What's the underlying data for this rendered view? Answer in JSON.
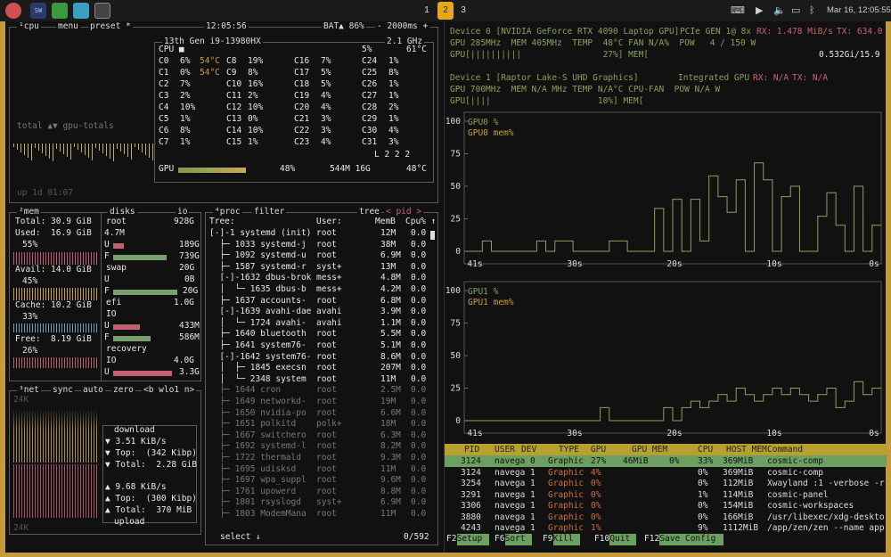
{
  "topbar": {
    "workspaces": [
      "1",
      "2",
      "3"
    ],
    "active_ws": "2",
    "datetime": "Mar 16, 12:05:55"
  },
  "cpu": {
    "header_num": "¹",
    "title": "cpu",
    "menu": "menu",
    "preset": "preset *",
    "time": "12:05:56",
    "bat": "BAT▲ 86%",
    "interval": "- 2000ms +",
    "model": "13th Gen i9-13980HX",
    "freq": "2.1 GHz",
    "total_pct": "5%",
    "total_temp": "61°C",
    "graph_label": "total ▲▼ gpu-totals",
    "uptime": "up 1d 01:07",
    "load": "L 2 2 2",
    "gpu_line": {
      "label": "GPU",
      "pct": "48%",
      "mem": "544M 16G",
      "temp": "48°C"
    },
    "cores": [
      [
        "C0",
        "6%",
        "54°C",
        "C8",
        "19%",
        "C16",
        "7%",
        "C24",
        "1%"
      ],
      [
        "C1",
        "0%",
        "54°C",
        "C9",
        "8%",
        "C17",
        "5%",
        "C25",
        "8%"
      ],
      [
        "C2",
        "7%",
        "",
        "C10",
        "16%",
        "C18",
        "5%",
        "C26",
        "1%"
      ],
      [
        "C3",
        "2%",
        "",
        "C11",
        "2%",
        "C19",
        "4%",
        "C27",
        "1%"
      ],
      [
        "C4",
        "10%",
        "",
        "C12",
        "10%",
        "C20",
        "4%",
        "C28",
        "2%"
      ],
      [
        "C5",
        "1%",
        "",
        "C13",
        "0%",
        "C21",
        "3%",
        "C29",
        "1%"
      ],
      [
        "C6",
        "8%",
        "",
        "C14",
        "10%",
        "C22",
        "3%",
        "C30",
        "4%"
      ],
      [
        "C7",
        "1%",
        "",
        "C15",
        "1%",
        "C23",
        "4%",
        "C31",
        "3%"
      ]
    ]
  },
  "mem": {
    "num": "²",
    "title": "mem",
    "total": "Total: 30.9 GiB",
    "used": "Used:  16.9 GiB",
    "used_pct": "55%",
    "avail": "Avail: 14.0 GiB",
    "avail_pct": "45%",
    "cache": "Cache: 10.2 GiB",
    "cache_pct": "33%",
    "free": "Free:  8.19 GiB",
    "free_pct": "26%"
  },
  "disks": {
    "title": "disks",
    "io": "io",
    "root": "root",
    "root_size": "928G",
    "root_io": "4.7M",
    "root_u": "189G",
    "root_f": "739G",
    "swap": "swap",
    "swap_size": "20G",
    "swap_u": "0B",
    "swap_f": "20G",
    "efi": "efi",
    "efi_size": "1.0G",
    "efi_io": "IO",
    "efi_u": "433M",
    "efi_f": "586M",
    "recovery": "recovery",
    "rec_size": "4.0G",
    "rec_io": "IO",
    "rec_u": "3.3G",
    "u": "U",
    "f": "F"
  },
  "net": {
    "num": "³",
    "title": "net",
    "sync": "sync",
    "auto": "auto",
    "zero": "zero",
    "iface": "<b wlo1 n>",
    "scale_top": "24K",
    "scale_bot": "24K",
    "download": "download",
    "dl_rate": "▼ 3.51 KiB/s",
    "dl_top": "▼ Top:  (342 Kibp)",
    "dl_total": "▼ Total:  2.28 GiB",
    "ul_rate": "▲ 9.68 KiB/s",
    "ul_top": "▲ Top:  (300 Kibp)",
    "ul_total": "▲ Total:  370 MiB",
    "upload": "upload"
  },
  "proc": {
    "num": "⁴",
    "title": "proc",
    "filter": "filter",
    "tree": "tree",
    "sort": "< pid >",
    "hdr_tree": "Tree:",
    "hdr_user": "User:",
    "hdr_mem": "MemB",
    "hdr_cpu": "Cpu% ↑",
    "select": "select ↓",
    "count": "0/592",
    "rows": [
      [
        "[-]-1 systemd (init)",
        "root",
        "12M",
        "0.0"
      ],
      [
        "  ├─ 1033 systemd-j",
        "root",
        "38M",
        "0.0"
      ],
      [
        "  ├─ 1092 systemd-u",
        "root",
        "6.9M",
        "0.0"
      ],
      [
        "  ├─ 1587 systemd-r",
        "syst+",
        "13M",
        "0.0"
      ],
      [
        "  [-]-1632 dbus-brok",
        "mess+",
        "4.8M",
        "0.0"
      ],
      [
        "  │  └─ 1635 dbus-b",
        "mess+",
        "4.2M",
        "0.0"
      ],
      [
        "  ├─ 1637 accounts-",
        "root",
        "6.8M",
        "0.0"
      ],
      [
        "  [-]-1639 avahi-dae",
        "avahi",
        "3.9M",
        "0.0"
      ],
      [
        "  │  └─ 1724 avahi-",
        "avahi",
        "1.1M",
        "0.0"
      ],
      [
        "  ├─ 1640 bluetooth",
        "root",
        "5.5M",
        "0.0"
      ],
      [
        "  ├─ 1641 system76-",
        "root",
        "5.1M",
        "0.0"
      ],
      [
        "  [-]-1642 system76-",
        "root",
        "8.6M",
        "0.0"
      ],
      [
        "  │  ├─ 1845 execsn",
        "root",
        "207M",
        "0.0"
      ],
      [
        "  │  └─ 2348 system",
        "root",
        "11M",
        "0.0"
      ],
      [
        "  ├─ 1644 cron",
        "root",
        "2.5M",
        "0.0"
      ],
      [
        "  ├─ 1649 networkd-",
        "root",
        "19M",
        "0.0"
      ],
      [
        "  ├─ 1650 nvidia-po",
        "root",
        "6.6M",
        "0.0"
      ],
      [
        "  ├─ 1651 polkitd",
        "polk+",
        "18M",
        "0.0"
      ],
      [
        "  ├─ 1667 switchero",
        "root",
        "6.3M",
        "0.0"
      ],
      [
        "  ├─ 1692 systemd-l",
        "root",
        "8.2M",
        "0.0"
      ],
      [
        "  ├─ 1722 thermald",
        "root",
        "9.3M",
        "0.0"
      ],
      [
        "  ├─ 1695 udisksd",
        "root",
        "11M",
        "0.0"
      ],
      [
        "  ├─ 1697 wpa_suppl",
        "root",
        "9.6M",
        "0.0"
      ],
      [
        "  ├─ 1761 upowerd",
        "root",
        "8.8M",
        "0.0"
      ],
      [
        "  ├─ 1801 rsyslogd",
        "syst+",
        "6.9M",
        "0.0"
      ],
      [
        "  ├─ 1803 ModemMana",
        "root",
        "11M",
        "0.0"
      ]
    ]
  },
  "gpu": {
    "dev0": "Device 0 [NVIDIA GeForce RTX 4090 Laptop GPU]",
    "pcie": "PCIe GEN 1@ 8x",
    "rx0": "RX: 1.478 MiB/s",
    "tx0": "TX: 634.0",
    "gpu0_line": "GPU 285MHz  MEM 405MHz  TEMP  48°C FAN N/A%  POW   4 / 150 W",
    "gpu0_bar": "GPU[||||||||||                27%] MEM[",
    "gpu0_mem": "0.532Gi/15.9",
    "dev1": "Device 1 [Raptor Lake-S UHD Graphics]",
    "integrated": "Integrated GPU",
    "rx1": "RX: N/A",
    "tx1": "TX: N/A",
    "gpu1_line": "GPU 700MHz  MEM N/A MHz TEMP N/A°C CPU-FAN  POW N/A W",
    "gpu1_bar": "GPU[||||                     10%] MEM[",
    "g0_legend1": "GPU0 %",
    "g0_legend2": "GPU0 mem%",
    "g1_legend1": "GPU1 %",
    "g1_legend2": "GPU1 mem%",
    "yticks": [
      "100",
      "75",
      "50",
      "25",
      "0"
    ],
    "xticks": [
      "41s",
      "30s",
      "20s",
      "10s",
      "0s"
    ],
    "proc_header": [
      "PID",
      "USER",
      "DEV",
      "TYPE",
      "GPU",
      "GPU MEM",
      "CPU",
      "HOST MEM",
      "Command"
    ],
    "procs": [
      [
        "3124",
        "navega",
        "0",
        "Graphic",
        "27%",
        "46MiB",
        "0%",
        "33%",
        "369MiB",
        "cosmic-comp"
      ],
      [
        "3124",
        "navega",
        "1",
        "Graphic",
        "4%",
        "",
        "",
        "0%",
        "369MiB",
        "cosmic-comp"
      ],
      [
        "3254",
        "navega",
        "1",
        "Graphic",
        "0%",
        "",
        "",
        "0%",
        "112MiB",
        "Xwayland :1 -verbose -r"
      ],
      [
        "3291",
        "navega",
        "1",
        "Graphic",
        "0%",
        "",
        "",
        "1%",
        "114MiB",
        "cosmic-panel"
      ],
      [
        "3306",
        "navega",
        "1",
        "Graphic",
        "0%",
        "",
        "",
        "0%",
        "154MiB",
        "cosmic-workspaces"
      ],
      [
        "3880",
        "navega",
        "1",
        "Graphic",
        "0%",
        "",
        "",
        "0%",
        "166MiB",
        "/usr/libexec/xdg-deskto"
      ],
      [
        "4243",
        "navega",
        "1",
        "Graphic",
        "1%",
        "",
        "",
        "9%",
        "1112MiB",
        "/app/zen/zen --name app"
      ]
    ],
    "fkeys": [
      [
        "F2",
        "Setup"
      ],
      [
        "F6",
        "Sort"
      ],
      [
        "F9",
        "Kill"
      ],
      [
        "F10",
        "Quit"
      ],
      [
        "F12",
        "Save Config"
      ]
    ]
  },
  "colors": {
    "accent": "#e6a818",
    "green": "#8aa15a",
    "orange": "#c8a040",
    "red": "#d06070"
  }
}
